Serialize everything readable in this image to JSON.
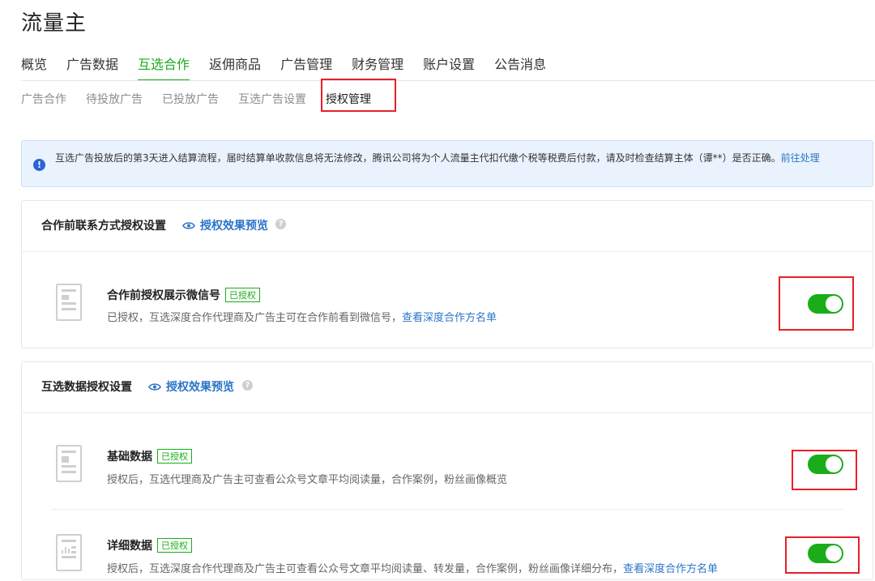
{
  "page": {
    "title": "流量主"
  },
  "main_nav": [
    {
      "label": "概览",
      "active": false
    },
    {
      "label": "广告数据",
      "active": false
    },
    {
      "label": "互选合作",
      "active": true
    },
    {
      "label": "返佣商品",
      "active": false
    },
    {
      "label": "广告管理",
      "active": false
    },
    {
      "label": "财务管理",
      "active": false
    },
    {
      "label": "账户设置",
      "active": false
    },
    {
      "label": "公告消息",
      "active": false
    }
  ],
  "sub_nav": [
    {
      "label": "广告合作",
      "active": false
    },
    {
      "label": "待投放广告",
      "active": false
    },
    {
      "label": "已投放广告",
      "active": false
    },
    {
      "label": "互选广告设置",
      "active": false
    },
    {
      "label": "授权管理",
      "active": true
    }
  ],
  "notice": {
    "icon": "info-icon",
    "text": "互选广告投放后的第3天进入结算流程，届时结算单收款信息将无法修改，腾讯公司将为个人流量主代扣代缴个税等税费后付款，请及时检查结算主体（谭**）是否正确。",
    "link": "前往处理"
  },
  "contact_section": {
    "title": "合作前联系方式授权设置",
    "preview_label": "授权效果预览",
    "items": [
      {
        "title": "合作前授权展示微信号",
        "badge": "已授权",
        "desc": "已授权，互选深度合作代理商及广告主可在合作前看到微信号，",
        "link": "查看深度合作方名单",
        "enabled": true
      }
    ]
  },
  "data_section": {
    "title": "互选数据授权设置",
    "preview_label": "授权效果预览",
    "items": [
      {
        "title": "基础数据",
        "badge": "已授权",
        "desc": "授权后，互选代理商及广告主可查看公众号文章平均阅读量，合作案例，粉丝画像概览",
        "enabled": true
      },
      {
        "title": "详细数据",
        "badge": "已授权",
        "desc": "授权后，互选深度合作代理商及广告主可查看公众号文章平均阅读量、转发量，合作案例，粉丝画像详细分布，",
        "link": "查看深度合作方名单",
        "enabled": true
      }
    ]
  },
  "colors": {
    "accent_green": "#1aad19",
    "link_blue": "#2b75c8",
    "highlight_red": "#e6202a",
    "notice_bg": "#eaf2fd"
  }
}
